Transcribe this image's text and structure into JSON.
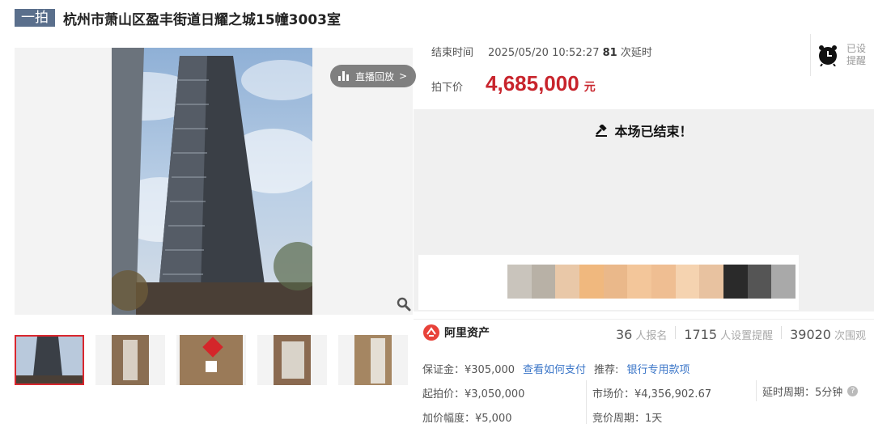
{
  "title": {
    "badge": "一拍",
    "text": "杭州市萧山区盈丰街道日耀之城15幢3003室"
  },
  "gallery": {
    "replay_label": "直播回放",
    "replay_chevron": ">",
    "icons": {
      "replay": "bar-chart-icon",
      "zoom": "magnifier-icon"
    },
    "thumbnail_count": 5
  },
  "auction": {
    "end_time_label": "结束时间",
    "end_time": "2025/05/20 10:52:27",
    "delay_count": "81",
    "delay_label": "次延时",
    "reminder_line1": "已设",
    "reminder_line2": "提醒",
    "price_label": "拍下价",
    "price": "4,685,000",
    "price_unit": "元",
    "ended_message": "本场已结束！",
    "accent_color": "#c8242c"
  },
  "stats": {
    "brand": "阿里资产",
    "signups": "36",
    "signups_label": "人报名",
    "reminders": "1715",
    "reminders_label": "人设置提醒",
    "views": "39020",
    "views_label": "次围观"
  },
  "details": {
    "deposit": "保证金：¥305,000",
    "pay_link": "查看如何支付",
    "recommend_label": "推荐:",
    "recommend_link": "银行专用款项",
    "start_price": "起拍价：¥3,050,000",
    "market_price": "市场价：¥4,356,902.67",
    "delay_period": "延时周期：5分钟",
    "increment": "加价幅度：¥5,000",
    "bid_period": "竞价周期：1天"
  }
}
